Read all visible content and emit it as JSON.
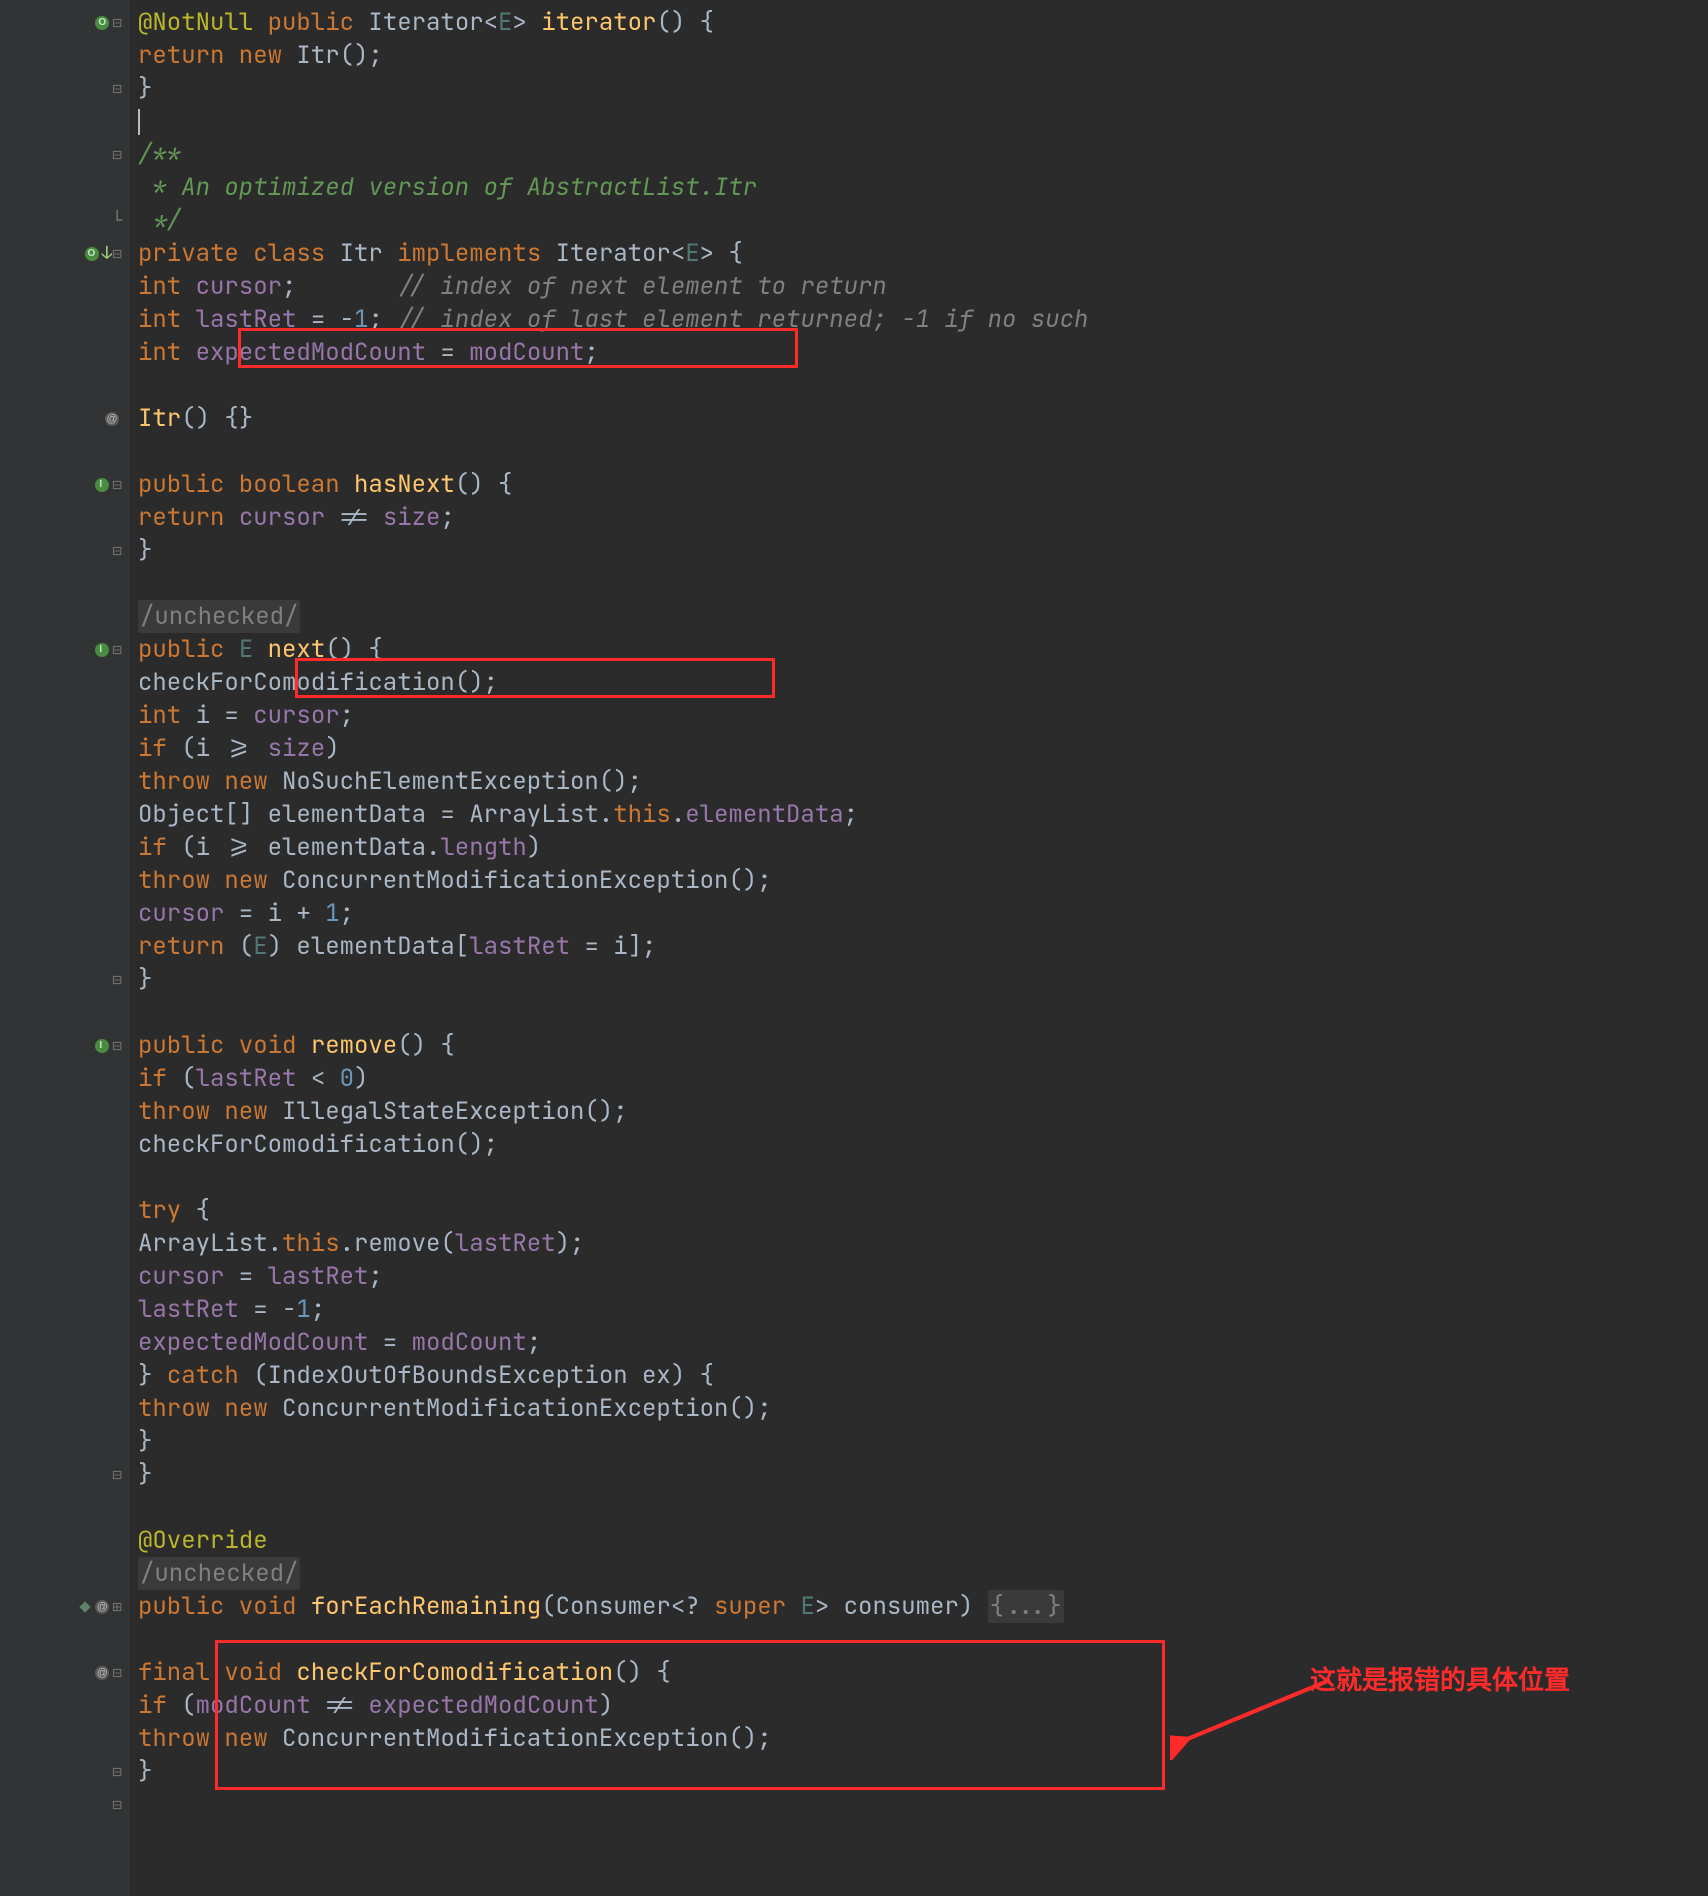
{
  "gutter_icons": {
    "override": "override-icon",
    "implements": "implements-icon",
    "at": "at-icon",
    "fold_open": "−",
    "fold_close": "⌄",
    "end": "end-icon"
  },
  "annotation": {
    "text": "这就是报错的具体位置"
  },
  "code": {
    "l0_a": "@NotNull",
    "l0_b": " public",
    "l0_c": " Iterator<",
    "l0_d": "E",
    "l0_e": "> ",
    "l0_f": "iterator",
    "l0_g": "() {",
    "l1_a": "return new",
    "l1_b": " Itr();",
    "l2": "}",
    "l4_a": "/**",
    "l5_a": " * An optimized version of AbstractList.Itr",
    "l6_a": " */",
    "l7_a": "private class ",
    "l7_b": "Itr ",
    "l7_c": "implements ",
    "l7_d": "Iterator<",
    "l7_e": "E",
    "l7_f": "> {",
    "l8_a": "int ",
    "l8_b": "cursor",
    "l8_c": ";       ",
    "l8_d": "// index of next element to return",
    "l9_a": "int ",
    "l9_b": "lastRet",
    "l9_c": " = -",
    "l9_d": "1",
    "l9_e": "; ",
    "l9_f": "// index of last element returned; -1 if no such",
    "l10_a": "int ",
    "l10_b": "expectedModCount",
    "l10_c": " = ",
    "l10_d": "modCount",
    "l10_e": ";",
    "l12_a": "Itr",
    "l12_b": "() {}",
    "l14_a": "public boolean ",
    "l14_b": "hasNext",
    "l14_c": "() {",
    "l15_a": "return ",
    "l15_b": "cursor",
    "l15_c": " != ",
    "l15_d": "size",
    "l15_e": ";",
    "l16": "}",
    "l18_a": "/unchecked/",
    "l19_a": "public ",
    "l19_b": "E ",
    "l19_c": "next",
    "l19_d": "() {",
    "l20_a": "checkForComodification();",
    "l21_a": "int ",
    "l21_b": "i = ",
    "l21_c": "cursor",
    "l21_d": ";",
    "l22_a": "if ",
    "l22_b": "(i >= ",
    "l22_c": "size",
    "l22_d": ")",
    "l23_a": "throw new ",
    "l23_b": "NoSuchElementException();",
    "l24_a": "Object[] elementData = ArrayList.",
    "l24_b": "this",
    "l24_c": ".",
    "l24_d": "elementData",
    "l24_e": ";",
    "l25_a": "if ",
    "l25_b": "(i >= elementData.",
    "l25_c": "length",
    "l25_d": ")",
    "l26_a": "throw new ",
    "l26_b": "ConcurrentModificationException();",
    "l27_a": "cursor",
    "l27_b": " = i + ",
    "l27_c": "1",
    "l27_d": ";",
    "l28_a": "return ",
    "l28_b": "(",
    "l28_c": "E",
    "l28_d": ") elementData[",
    "l28_e": "lastRet",
    "l28_f": " = i];",
    "l29": "}",
    "l31_a": "public void ",
    "l31_b": "remove",
    "l31_c": "() {",
    "l32_a": "if ",
    "l32_b": "(",
    "l32_c": "lastRet",
    "l32_d": " < ",
    "l32_e": "0",
    "l32_f": ")",
    "l33_a": "throw new ",
    "l33_b": "IllegalStateException();",
    "l34_a": "checkForComodification();",
    "l36_a": "try ",
    "l36_b": "{",
    "l37_a": "ArrayList.",
    "l37_b": "this",
    "l37_c": ".remove(",
    "l37_d": "lastRet",
    "l37_e": ");",
    "l38_a": "cursor",
    "l38_b": " = ",
    "l38_c": "lastRet",
    "l38_d": ";",
    "l39_a": "lastRet",
    "l39_b": " = -",
    "l39_c": "1",
    "l39_d": ";",
    "l40_a": "expectedModCount",
    "l40_b": " = ",
    "l40_c": "modCount",
    "l40_d": ";",
    "l41_a": "} ",
    "l41_b": "catch ",
    "l41_c": "(IndexOutOfBoundsException ex) {",
    "l42_a": "throw new ",
    "l42_b": "ConcurrentModificationException();",
    "l43": "}",
    "l44": "}",
    "l46_a": "@Override",
    "l47_a": "/unchecked/",
    "l48_a": "public void ",
    "l48_b": "forEachRemaining",
    "l48_c": "(Consumer<? ",
    "l48_d": "super ",
    "l48_e": "E",
    "l48_f": "> consumer) ",
    "l48_g": "{...}",
    "l50_a": "final void ",
    "l50_b": "checkForComodification",
    "l50_c": "() {",
    "l51_a": "if ",
    "l51_b": "(",
    "l51_c": "modCount",
    "l51_d": " != ",
    "l51_e": "expectedModCount",
    "l51_f": ")",
    "l52_a": "throw new ",
    "l52_b": "ConcurrentModificationException();",
    "l53": "}"
  }
}
